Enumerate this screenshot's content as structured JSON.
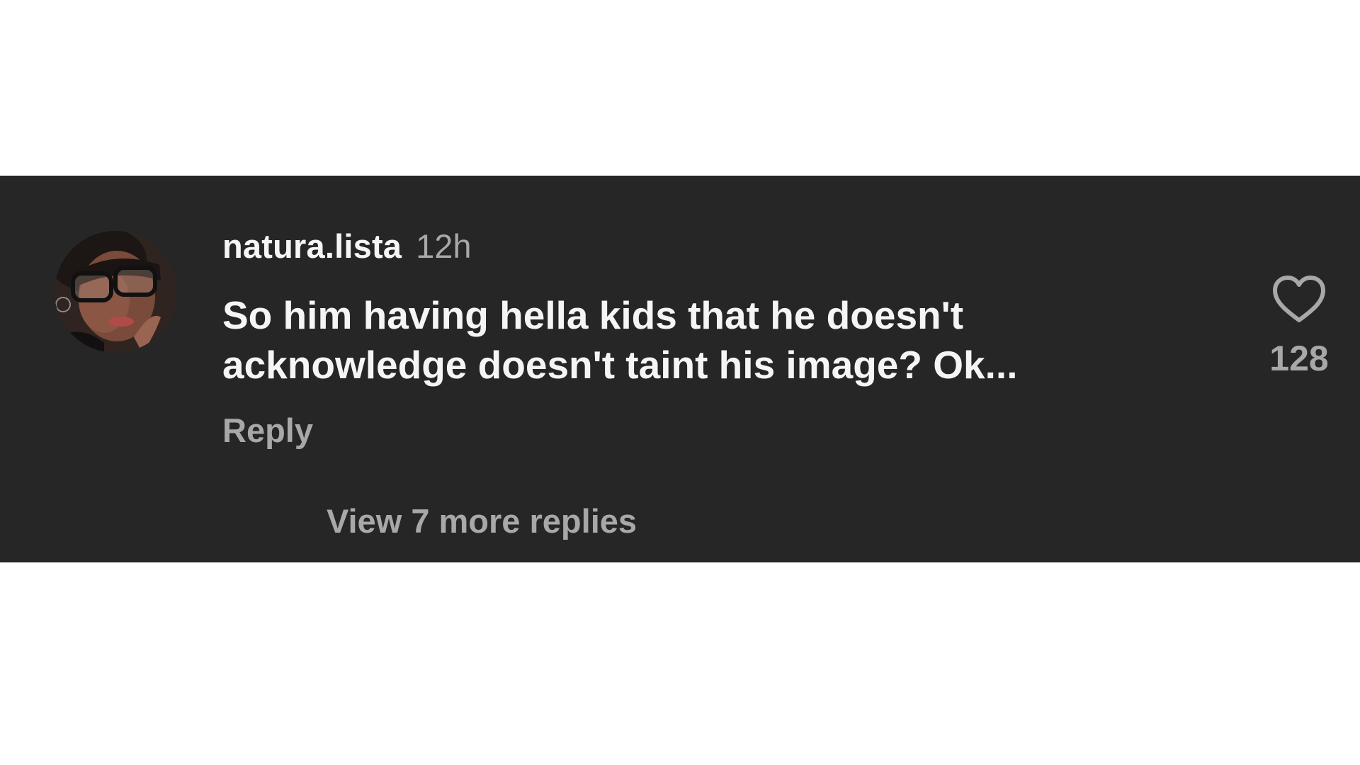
{
  "comment": {
    "username": "natura.lista",
    "time": "12h",
    "text": "So him having hella kids that he doesn't acknowledge doesn't taint his image? Ok...",
    "reply_label": "Reply",
    "like_count": "128",
    "like_icon": "heart-outline-icon"
  },
  "replies": {
    "view_more_label": "View 7 more replies"
  },
  "colors": {
    "panel_background": "#262626",
    "primary_text": "#f5f5f5",
    "secondary_text": "#a8a8a8"
  }
}
